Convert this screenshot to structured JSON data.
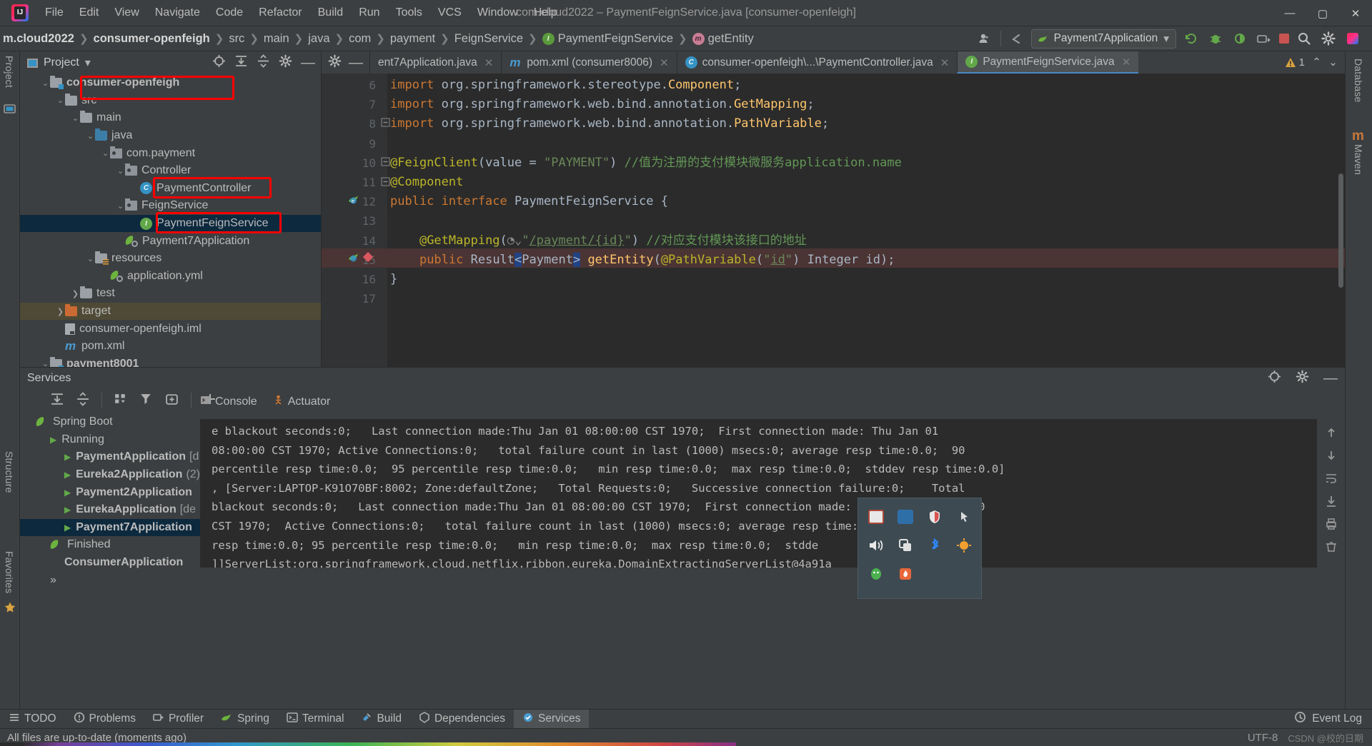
{
  "window": {
    "title": "com.cloud2022 – PaymentFeignService.java [consumer-openfeigh]",
    "minimize": "—",
    "maximize": "▢",
    "close": "✕"
  },
  "menu": [
    "File",
    "Edit",
    "View",
    "Navigate",
    "Code",
    "Refactor",
    "Build",
    "Run",
    "Tools",
    "VCS",
    "Window",
    "Help"
  ],
  "breadcrumb": {
    "items": [
      "m.cloud2022",
      "consumer-openfeigh",
      "src",
      "main",
      "java",
      "com",
      "payment",
      "FeignService",
      "PaymentFeignService",
      "getEntity"
    ],
    "separator": "❯",
    "interface_icon": "I",
    "method_icon": "m"
  },
  "toolbar": {
    "run_config": "Payment7Application",
    "chevron": "▾",
    "icons": [
      "user-icon",
      "back-arrow-icon",
      "spring-leaf-icon",
      "update-icon",
      "debug-icon",
      "coverage-icon",
      "profiler-icon",
      "stop-icon",
      "search-icon",
      "settings-icon",
      "ide-icon"
    ]
  },
  "left_stripe": {
    "items": [
      "Project",
      "Structure",
      "Favorites"
    ]
  },
  "right_stripe": {
    "items": [
      "Database",
      "Maven"
    ]
  },
  "project_panel": {
    "title": "Project",
    "chevron": "▾",
    "toolbar_icons": [
      "locate-icon",
      "expand-all-icon",
      "collapse-all-icon",
      "settings-icon",
      "hide-icon"
    ],
    "tree": [
      {
        "label": "consumer-openfeigh",
        "indent": 1,
        "arrow": "⌄",
        "icon": "module-folder",
        "bold": true,
        "highlight": true
      },
      {
        "label": "src",
        "indent": 2,
        "arrow": "⌄",
        "icon": "source-folder",
        "bold": false,
        "highlight": false
      },
      {
        "label": "main",
        "indent": 3,
        "arrow": "⌄",
        "icon": "folder",
        "bold": false,
        "highlight": false
      },
      {
        "label": "java",
        "indent": 4,
        "arrow": "⌄",
        "icon": "source-folder-blue",
        "bold": false,
        "highlight": false
      },
      {
        "label": "com.payment",
        "indent": 5,
        "arrow": "⌄",
        "icon": "package",
        "bold": false,
        "highlight": false
      },
      {
        "label": "Controller",
        "indent": 6,
        "arrow": "⌄",
        "icon": "package",
        "bold": false,
        "highlight": false
      },
      {
        "label": "PaymentController",
        "indent": 7,
        "arrow": "",
        "icon": "class",
        "bold": false,
        "highlight": true
      },
      {
        "label": "FeignService",
        "indent": 6,
        "arrow": "⌄",
        "icon": "package",
        "bold": false,
        "highlight": false
      },
      {
        "label": "PaymentFeignService",
        "indent": 7,
        "arrow": "",
        "icon": "interface",
        "bold": false,
        "highlight": true,
        "selected": true
      },
      {
        "label": "Payment7Application",
        "indent": 6,
        "arrow": "",
        "icon": "spring-class",
        "bold": false,
        "highlight": false
      },
      {
        "label": "resources",
        "indent": 4,
        "arrow": "⌄",
        "icon": "resources-folder",
        "bold": false,
        "highlight": false
      },
      {
        "label": "application.yml",
        "indent": 5,
        "arrow": "",
        "icon": "spring-yml",
        "bold": false,
        "highlight": false
      },
      {
        "label": "test",
        "indent": 3,
        "arrow": "❯",
        "icon": "folder",
        "bold": false,
        "highlight": false
      },
      {
        "label": "target",
        "indent": 2,
        "arrow": "❯",
        "icon": "target-folder",
        "bold": false,
        "highlight": false,
        "rowhighlight": true
      },
      {
        "label": "consumer-openfeigh.iml",
        "indent": 2,
        "arrow": "",
        "icon": "iml-file",
        "bold": false,
        "highlight": false
      },
      {
        "label": "pom.xml",
        "indent": 2,
        "arrow": "",
        "icon": "maven-file",
        "bold": false,
        "highlight": false
      },
      {
        "label": "payment8001",
        "indent": 1,
        "arrow": "⌄",
        "icon": "module-folder",
        "bold": true,
        "highlight": false
      }
    ]
  },
  "editor": {
    "tabs": [
      {
        "label": "ent7Application.java",
        "icon": "spring-class-icon",
        "active": false,
        "close": "✕"
      },
      {
        "label": "pom.xml (consumer8006)",
        "icon": "maven-icon",
        "active": false,
        "close": "✕"
      },
      {
        "label": "consumer-openfeigh\\...\\PaymentController.java",
        "icon": "class-icon",
        "active": false,
        "close": "✕"
      },
      {
        "label": "PaymentFeignService.java",
        "icon": "interface-icon",
        "active": true,
        "close": "✕"
      }
    ],
    "warning_count": "1",
    "warning_icon": "warning-triangle-icon",
    "nav_up": "⌃",
    "nav_down": "⌄",
    "tabs_more": "⌄",
    "line_numbers": [
      "6",
      "7",
      "8",
      "9",
      "10",
      "11",
      "12",
      "13",
      "14",
      "15",
      "16",
      "17"
    ],
    "code_lines": [
      {
        "n": "6",
        "text": "import org.springframework.stereotype.Component;"
      },
      {
        "n": "7",
        "text": "import org.springframework.web.bind.annotation.GetMapping;"
      },
      {
        "n": "8",
        "text": "import org.springframework.web.bind.annotation.PathVariable;"
      },
      {
        "n": "9",
        "text": ""
      },
      {
        "n": "10",
        "text": "@FeignClient(value = \"PAYMENT\") //值为注册的支付模块微服务application.name"
      },
      {
        "n": "11",
        "text": "@Component"
      },
      {
        "n": "12",
        "text": "public interface PaymentFeignService {"
      },
      {
        "n": "13",
        "text": ""
      },
      {
        "n": "14",
        "text": "    @GetMapping(\"/payment/{id}\") //对应支付模块该接口的地址"
      },
      {
        "n": "15",
        "text": "    public Result<Payment> getEntity(@PathVariable(\"id\") Integer id);"
      },
      {
        "n": "16",
        "text": "}"
      },
      {
        "n": "17",
        "text": ""
      }
    ]
  },
  "services": {
    "title": "Services",
    "toolbar_icons": [
      "rerun-icon",
      "expand-all-icon",
      "collapse-all-icon",
      "group-icon",
      "filter-icon",
      "add-tab-icon",
      "add-icon"
    ],
    "side_icons": [
      "rerun-icon",
      "debug-icon",
      "stop-icon"
    ],
    "console_tabs": [
      {
        "label": "Console",
        "icon": "console-icon"
      },
      {
        "label": "Actuator",
        "icon": "actuator-icon"
      }
    ],
    "tree": [
      {
        "label": "Spring Boot",
        "indent": 0,
        "icon": "spring-icon",
        "arrow": ""
      },
      {
        "label": "Running",
        "indent": 1,
        "icon": "",
        "arrow": "▶"
      },
      {
        "label": "PaymentApplication",
        "indent": 2,
        "icon": "",
        "arrow": "▶",
        "suffix": "[d",
        "bold": true
      },
      {
        "label": "Eureka2Application",
        "indent": 2,
        "icon": "",
        "arrow": "▶",
        "suffix": "(2)",
        "bold": true
      },
      {
        "label": "Payment2Application",
        "indent": 2,
        "icon": "",
        "arrow": "▶",
        "suffix": "",
        "bold": true
      },
      {
        "label": "EurekaApplication",
        "indent": 2,
        "icon": "",
        "arrow": "▶",
        "suffix": "[de",
        "bold": true
      },
      {
        "label": "Payment7Application",
        "indent": 2,
        "icon": "",
        "arrow": "▶",
        "suffix": "",
        "bold": true,
        "selected": true
      },
      {
        "label": "Finished",
        "indent": 1,
        "icon": "finished-icon",
        "arrow": ""
      },
      {
        "label": "ConsumerApplication",
        "indent": 2,
        "icon": "",
        "arrow": "",
        "bold": true
      },
      {
        "label": "»",
        "indent": 1,
        "icon": "",
        "arrow": ""
      }
    ],
    "console_text": "e blackout seconds:0;   Last connection made:Thu Jan 01 08:00:00 CST 1970;  First connection made: Thu Jan 01\n08:00:00 CST 1970; Active Connections:0;   total failure count in last (1000) msecs:0; average resp time:0.0;  90\npercentile resp time:0.0;  95 percentile resp time:0.0;   min resp time:0.0;  max resp time:0.0;  stddev resp time:0.0]\n, [Server:LAPTOP-K91O70BF:8002; Zone:defaultZone;   Total Requests:0;   Successive connection failure:0;    Total\nblackout seconds:0;   Last connection made:Thu Jan 01 08:00:00 CST 1970;  First connection made: Thu Jan 01 08:00:00\nCST 1970;  Active Connections:0;   total failure count in last (1000) msecs:0; average resp time:0.0;          tile\nresp time:0.0; 95 percentile resp time:0.0;   min resp time:0.0;  max resp time:0.0;  stdde\n]]ServerList:org.springframework.cloud.netflix.ribbon.eureka.DomainExtractingServerList@4a91a",
    "console_side_icons": [
      "scroll-up-icon",
      "scroll-down-icon",
      "soft-wrap-icon",
      "scroll-end-icon",
      "print-icon",
      "trash-icon"
    ]
  },
  "bottom_tabs": [
    {
      "label": "TODO",
      "icon": "todo-icon",
      "active": false
    },
    {
      "label": "Problems",
      "icon": "problems-icon",
      "active": false
    },
    {
      "label": "Profiler",
      "icon": "profiler-icon",
      "active": false
    },
    {
      "label": "Spring",
      "icon": "spring-icon",
      "active": false
    },
    {
      "label": "Terminal",
      "icon": "terminal-icon",
      "active": false
    },
    {
      "label": "Build",
      "icon": "build-icon",
      "active": false
    },
    {
      "label": "Dependencies",
      "icon": "dependencies-icon",
      "active": false
    },
    {
      "label": "Services",
      "icon": "services-icon",
      "active": true
    }
  ],
  "event_log": {
    "label": "Event Log",
    "icon": "event-log-icon"
  },
  "status_bar": {
    "message": "All files are up-to-date (moments ago)",
    "encoding": "UTF-8",
    "watermark": "CSDN @校的日期"
  },
  "tray": {
    "icons": [
      "screenshot-icon",
      "translate-icon",
      "shield-icon",
      "mouse-icon",
      "volume-icon",
      "copy-icon",
      "bluetooth-icon",
      "weather-icon",
      "qq-icon",
      "flame-icon"
    ]
  },
  "colors": {
    "accent_blue": "#3592c4",
    "highlight_red": "#fe0000",
    "selection_blue": "#0d293e",
    "green": "#62a84a",
    "orange": "#cc7832"
  }
}
